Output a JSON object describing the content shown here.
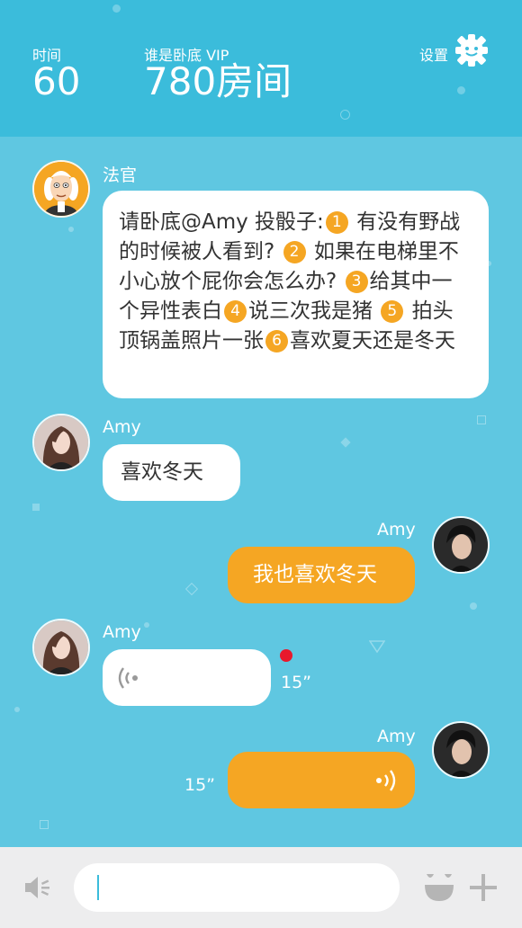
{
  "header": {
    "time_label": "时间",
    "time_value": "60",
    "room_label": "谁是卧底  VIP",
    "room_value": "780房间",
    "settings_label": "设置"
  },
  "messages": [
    {
      "sender": "法官",
      "segments": [
        "请卧底@Amy  投骰子:",
        "1",
        " 有没有野战的时候被人看到? ",
        "2",
        " 如果在电梯里不小心放个屁你会怎么办? ",
        "3",
        "给其中一个异性表白",
        "4",
        "说三次我是猪 ",
        "5",
        " 拍头顶锅盖照片一张",
        "6",
        "喜欢夏天还是冬天"
      ]
    },
    {
      "sender": "Amy",
      "text": "喜欢冬天"
    },
    {
      "sender": "Amy",
      "text": "我也喜欢冬天"
    },
    {
      "sender": "Amy",
      "duration": "15”"
    },
    {
      "sender": "Amy",
      "duration": "15”"
    }
  ],
  "input": {
    "value": ""
  },
  "colors": {
    "header_bg": "#3bbcdb",
    "chat_bg": "#5fc7e1",
    "accent_orange": "#f5a623",
    "unread_red": "#e8192c",
    "bottom_bar": "#ededee"
  },
  "icons": [
    "settings-gear-icon",
    "judge-avatar",
    "female-avatar",
    "male-avatar",
    "voice-wave-icon",
    "speaker-icon",
    "emoji-icon",
    "plus-icon"
  ]
}
